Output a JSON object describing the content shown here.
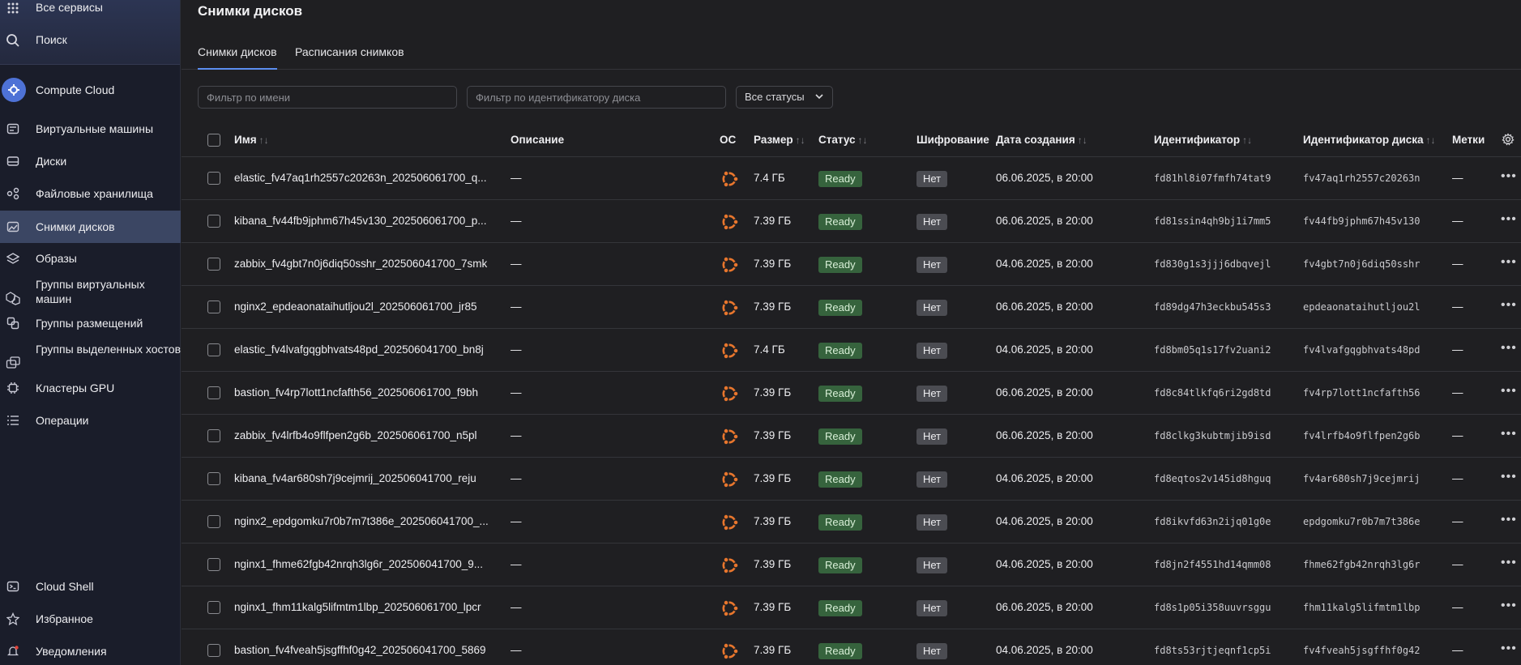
{
  "sidebar": {
    "top": [
      {
        "label": "Все сервисы",
        "icon": "grid-icon"
      },
      {
        "label": "Поиск",
        "icon": "search-icon"
      }
    ],
    "service": {
      "label": "Compute Cloud",
      "icon": "compute-cloud-icon",
      "accent": "#4e72d6"
    },
    "items": [
      {
        "label": "Виртуальные машины",
        "icon": "vm-icon"
      },
      {
        "label": "Диски",
        "icon": "disk-icon"
      },
      {
        "label": "Файловые хранилища",
        "icon": "file-storage-icon"
      },
      {
        "label": "Снимки дисков",
        "icon": "snapshot-icon",
        "active": true
      },
      {
        "label": "Образы",
        "icon": "images-icon"
      },
      {
        "label": "Группы виртуальных машин",
        "icon": "instance-groups-icon"
      },
      {
        "label": "Группы размещений",
        "icon": "placement-groups-icon"
      },
      {
        "label": "Группы выделенных хостов",
        "icon": "host-groups-icon"
      },
      {
        "label": "Кластеры GPU",
        "icon": "gpu-icon"
      },
      {
        "label": "Операции",
        "icon": "operations-icon"
      }
    ],
    "bottom": [
      {
        "label": "Cloud Shell",
        "icon": "terminal-icon"
      },
      {
        "label": "Избранное",
        "icon": "star-icon"
      },
      {
        "label": "Уведомления",
        "icon": "bell-icon"
      }
    ]
  },
  "page": {
    "title": "Снимки дисков",
    "tabs": [
      {
        "label": "Снимки дисков",
        "active": true
      },
      {
        "label": "Расписания снимков",
        "active": false
      }
    ],
    "filters": {
      "name_placeholder": "Фильтр по имени",
      "disk_placeholder": "Фильтр по идентификатору диска",
      "status_value": "Все статусы"
    }
  },
  "table": {
    "columns": {
      "name": "Имя",
      "description": "Описание",
      "os": "ОС",
      "size": "Размер",
      "status": "Статус",
      "encryption": "Шифрование",
      "created": "Дата создания",
      "id": "Идентификатор",
      "disk_id": "Идентификатор диска",
      "labels": "Метки"
    },
    "rows": [
      {
        "name": "elastic_fv47aq1rh2557c20263n_202506061700_q...",
        "description": "—",
        "size": "7.4 ГБ",
        "status": "Ready",
        "encryption": "Нет",
        "created": "06.06.2025, в 20:00",
        "id": "fd81hl8i07fmfh74tat9",
        "disk_id": "fv47aq1rh2557c20263n",
        "labels": "—"
      },
      {
        "name": "kibana_fv44fb9jphm67h45v130_202506061700_p...",
        "description": "—",
        "size": "7.39 ГБ",
        "status": "Ready",
        "encryption": "Нет",
        "created": "06.06.2025, в 20:00",
        "id": "fd81ssin4qh9bj1i7mm5",
        "disk_id": "fv44fb9jphm67h45v130",
        "labels": "—"
      },
      {
        "name": "zabbix_fv4gbt7n0j6diq50sshr_202506041700_7smk",
        "description": "—",
        "size": "7.39 ГБ",
        "status": "Ready",
        "encryption": "Нет",
        "created": "04.06.2025, в 20:00",
        "id": "fd830g1s3jjj6dbqvejl",
        "disk_id": "fv4gbt7n0j6diq50sshr",
        "labels": "—"
      },
      {
        "name": "nginx2_epdeaonataihutljou2l_202506061700_jr85",
        "description": "—",
        "size": "7.39 ГБ",
        "status": "Ready",
        "encryption": "Нет",
        "created": "06.06.2025, в 20:00",
        "id": "fd89dg47h3eckbu545s3",
        "disk_id": "epdeaonataihutljou2l",
        "labels": "—"
      },
      {
        "name": "elastic_fv4lvafgqgbhvats48pd_202506041700_bn8j",
        "description": "—",
        "size": "7.4 ГБ",
        "status": "Ready",
        "encryption": "Нет",
        "created": "04.06.2025, в 20:00",
        "id": "fd8bm05q1s17fv2uani2",
        "disk_id": "fv4lvafgqgbhvats48pd",
        "labels": "—"
      },
      {
        "name": "bastion_fv4rp7lott1ncfafth56_202506061700_f9bh",
        "description": "—",
        "size": "7.39 ГБ",
        "status": "Ready",
        "encryption": "Нет",
        "created": "06.06.2025, в 20:00",
        "id": "fd8c84tlkfq6ri2gd8td",
        "disk_id": "fv4rp7lott1ncfafth56",
        "labels": "—"
      },
      {
        "name": "zabbix_fv4lrfb4o9flfpen2g6b_202506061700_n5pl",
        "description": "—",
        "size": "7.39 ГБ",
        "status": "Ready",
        "encryption": "Нет",
        "created": "06.06.2025, в 20:00",
        "id": "fd8clkg3kubtmjib9isd",
        "disk_id": "fv4lrfb4o9flfpen2g6b",
        "labels": "—"
      },
      {
        "name": "kibana_fv4ar680sh7j9cejmrij_202506041700_reju",
        "description": "—",
        "size": "7.39 ГБ",
        "status": "Ready",
        "encryption": "Нет",
        "created": "04.06.2025, в 20:00",
        "id": "fd8eqtos2v145id8hguq",
        "disk_id": "fv4ar680sh7j9cejmrij",
        "labels": "—"
      },
      {
        "name": "nginx2_epdgomku7r0b7m7t386e_202506041700_...",
        "description": "—",
        "size": "7.39 ГБ",
        "status": "Ready",
        "encryption": "Нет",
        "created": "04.06.2025, в 20:00",
        "id": "fd8ikvfd63n2ijq01g0e",
        "disk_id": "epdgomku7r0b7m7t386e",
        "labels": "—"
      },
      {
        "name": "nginx1_fhme62fgb42nrqh3lg6r_202506041700_9...",
        "description": "—",
        "size": "7.39 ГБ",
        "status": "Ready",
        "encryption": "Нет",
        "created": "04.06.2025, в 20:00",
        "id": "fd8jn2f4551hd14qmm08",
        "disk_id": "fhme62fgb42nrqh3lg6r",
        "labels": "—"
      },
      {
        "name": "nginx1_fhm11kalg5lifmtm1lbp_202506061700_lpcr",
        "description": "—",
        "size": "7.39 ГБ",
        "status": "Ready",
        "encryption": "Нет",
        "created": "06.06.2025, в 20:00",
        "id": "fd8s1p05i358uuvrsggu",
        "disk_id": "fhm11kalg5lifmtm1lbp",
        "labels": "—"
      },
      {
        "name": "bastion_fv4fveah5jsgffhf0g42_202506041700_5869",
        "description": "—",
        "size": "7.39 ГБ",
        "status": "Ready",
        "encryption": "Нет",
        "created": "04.06.2025, в 20:00",
        "id": "fd8ts53rjtjeqnf1cp5i",
        "disk_id": "fv4fveah5jsgffhf0g42",
        "labels": "—"
      }
    ]
  },
  "colors": {
    "ready": "#36633d",
    "os_icon": "#e8762d",
    "active_tab": "#5c8ef0"
  }
}
